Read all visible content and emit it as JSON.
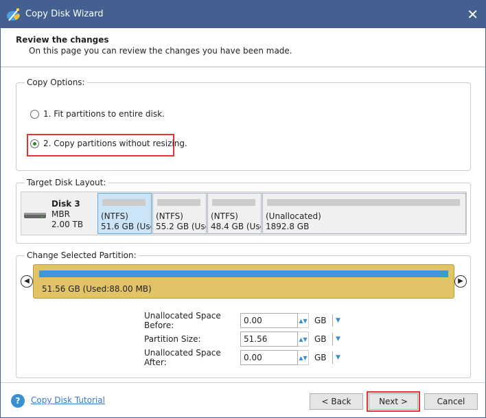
{
  "window": {
    "title": "Copy Disk Wizard",
    "close": "✕"
  },
  "header": {
    "title": "Review the changes",
    "subtitle": "On this page you can review the changes you have been made."
  },
  "copy_options": {
    "label": "Copy Options:",
    "options": [
      {
        "label": "1. Fit partitions to entire disk.",
        "selected": false
      },
      {
        "label": "2. Copy partitions without resizing.",
        "selected": true
      }
    ]
  },
  "target_layout": {
    "label": "Target Disk Layout:",
    "disk": {
      "name": "Disk 3",
      "type": "MBR",
      "size": "2.00 TB"
    },
    "partitions": [
      {
        "fs": "(NTFS)",
        "size": "51.6 GB (Used",
        "selected": true
      },
      {
        "fs": "(NTFS)",
        "size": "55.2 GB (Used",
        "selected": false
      },
      {
        "fs": "(NTFS)",
        "size": "48.4 GB (Used",
        "selected": false
      },
      {
        "fs": "(Unallocated)",
        "size": "1892.8 GB",
        "selected": false
      }
    ]
  },
  "change_partition": {
    "label": "Change Selected Partition:",
    "bar_text": "51.56 GB (Used:88.00 MB)",
    "fields": [
      {
        "label": "Unallocated Space Before:",
        "value": "0.00",
        "unit": "GB"
      },
      {
        "label": "Partition Size:",
        "value": "51.56",
        "unit": "GB"
      },
      {
        "label": "Unallocated Space After:",
        "value": "0.00",
        "unit": "GB"
      }
    ]
  },
  "footer": {
    "tutorial": "Copy Disk Tutorial",
    "back": "< Back",
    "next": "Next >",
    "cancel": "Cancel"
  },
  "colors": {
    "titlebar": "#436090",
    "highlight": "#e53333",
    "partition_bar": "#3a9ad9",
    "partition_body": "#e2c466"
  }
}
